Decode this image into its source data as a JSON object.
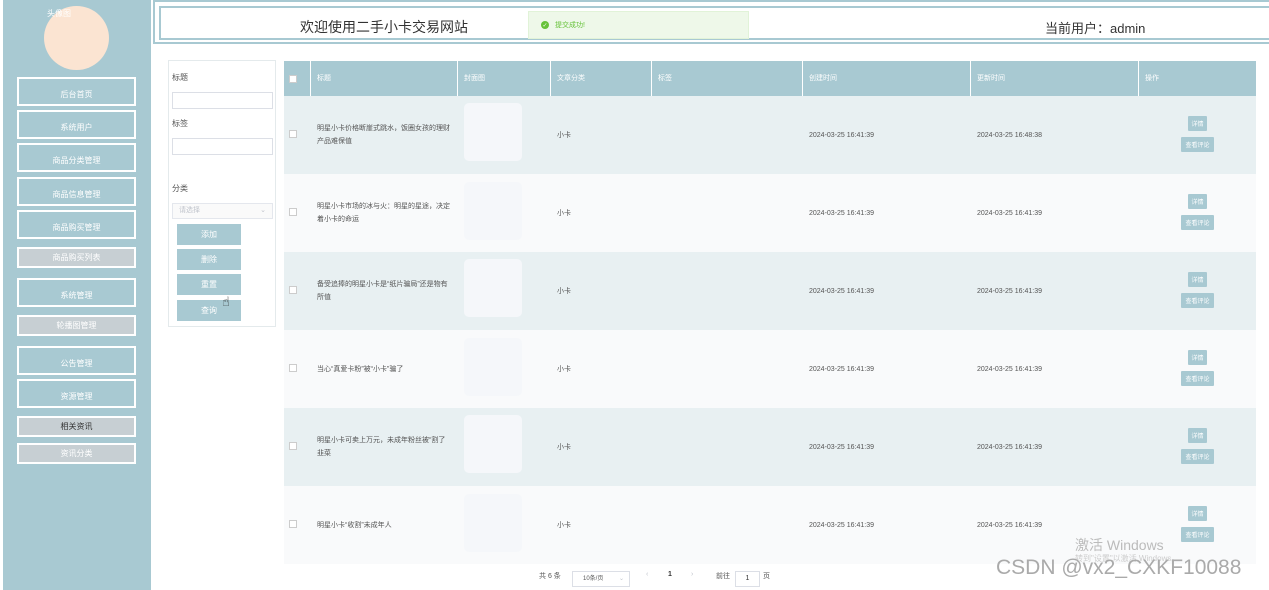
{
  "sidebar": {
    "avatar_alt": "头像图",
    "items": [
      {
        "label": "后台首页"
      },
      {
        "label": "系统用户"
      },
      {
        "label": "商品分类管理"
      },
      {
        "label": "商品信息管理"
      },
      {
        "label": "商品购买管理"
      },
      {
        "label": "商品购买列表"
      },
      {
        "label": "系统管理"
      },
      {
        "label": "轮播图管理"
      },
      {
        "label": "公告管理"
      },
      {
        "label": "资源管理"
      },
      {
        "label": "相关资讯"
      },
      {
        "label": "资讯分类"
      }
    ]
  },
  "header": {
    "title": "欢迎使用二手小卡交易网站",
    "user_label": "当前用户：admin"
  },
  "toast": {
    "message": "提交成功!"
  },
  "filter": {
    "title_label": "标题",
    "tag_label": "标签",
    "category_label": "分类",
    "category_placeholder": "请选择",
    "buttons": {
      "add": "添加",
      "delete": "删除",
      "reset": "重置",
      "query": "查询"
    }
  },
  "table": {
    "headers": [
      "标题",
      "封面图",
      "文章分类",
      "标签",
      "创建时间",
      "更新时间",
      "操作"
    ],
    "rows": [
      {
        "title": "明星小卡价格断崖式跳水，饭圈女孩的理财产品难保值",
        "category": "小卡",
        "tag": "",
        "created": "2024-03-25 16:41:39",
        "updated": "2024-03-25 16:48:38"
      },
      {
        "title": "明星小卡市场的冰与火：明星的星途，决定着小卡的命运",
        "category": "小卡",
        "tag": "",
        "created": "2024-03-25 16:41:39",
        "updated": "2024-03-25 16:41:39"
      },
      {
        "title": "备受追捧的明星小卡是“纸片骗局”还是物有所值",
        "category": "小卡",
        "tag": "",
        "created": "2024-03-25 16:41:39",
        "updated": "2024-03-25 16:41:39"
      },
      {
        "title": "当心“真爱卡粉”被“小卡”骗了",
        "category": "小卡",
        "tag": "",
        "created": "2024-03-25 16:41:39",
        "updated": "2024-03-25 16:41:39"
      },
      {
        "title": "明星小卡可卖上万元，未成年粉丝被“割了韭菜",
        "category": "小卡",
        "tag": "",
        "created": "2024-03-25 16:41:39",
        "updated": "2024-03-25 16:41:39"
      },
      {
        "title": "明星小卡“收割”未成年人",
        "category": "小卡",
        "tag": "",
        "created": "2024-03-25 16:41:39",
        "updated": "2024-03-25 16:41:39"
      }
    ],
    "op_detail": "详情",
    "op_comments": "查看评论"
  },
  "pagination": {
    "total": "共 6 条",
    "page_size": "10条/页",
    "prev": "‹",
    "current": "1",
    "next": "›",
    "goto_label": "前往",
    "goto_value": "1",
    "page_unit": "页"
  },
  "watermark": {
    "activate_title": "激活 Windows",
    "activate_sub": "转到\"设置\"以激活 Windows。",
    "csdn": "CSDN @vx2_CXKF10088"
  },
  "colors": {
    "accent": "#a8c9d2",
    "toast": "#67c23a"
  }
}
